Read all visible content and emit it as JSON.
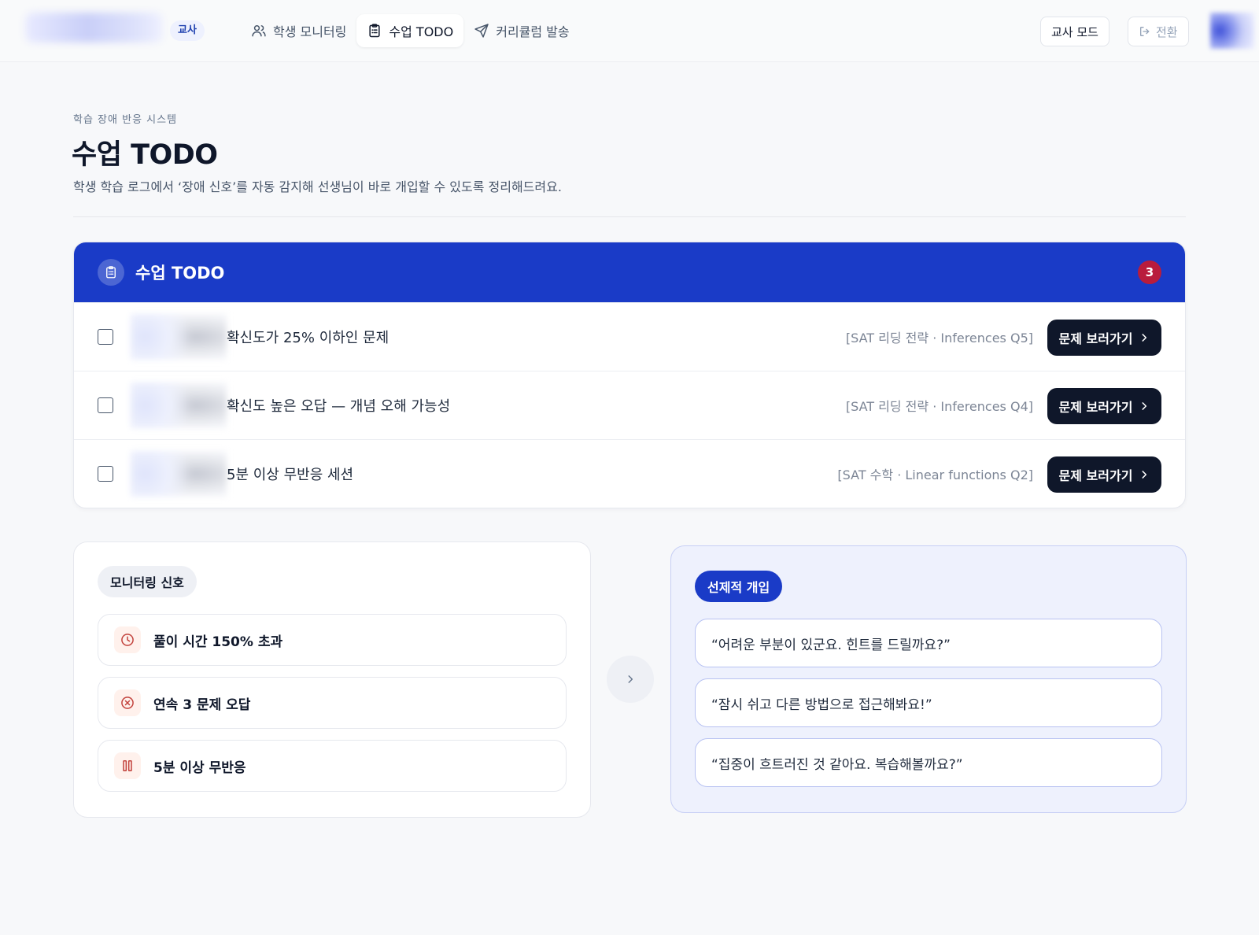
{
  "nav": {
    "role_badge": "교사",
    "items": [
      {
        "label": "학생 모니터링",
        "icon": "users-icon",
        "active": false
      },
      {
        "label": "수업 TODO",
        "icon": "clipboard-icon",
        "active": true
      },
      {
        "label": "커리큘럼 발송",
        "icon": "send-icon",
        "active": false
      }
    ],
    "teacher_mode_label": "교사 모드",
    "switch_label": "전환"
  },
  "header": {
    "kicker": "학습 장애 반응 시스템",
    "title": "수업 TODO",
    "description": "학생 학습 로그에서 ‘장애 신호’를 자동 감지해 선생님이 바로 개입할 수 있도록 정리해드려요."
  },
  "todo": {
    "title": "수업 TODO",
    "count": "3",
    "action_label": "문제 보러가기",
    "items": [
      {
        "text": "확신도가 25% 이하인 문제",
        "source": "[SAT 리딩 전략 · Inferences Q5]"
      },
      {
        "text": "확신도 높은 오답 — 개념 오해 가능성",
        "source": "[SAT 리딩 전략 · Inferences Q4]"
      },
      {
        "text": "5분 이상 무반응 세션",
        "source": "[SAT 수학 · Linear functions Q2]"
      }
    ]
  },
  "signals": {
    "chip": "모니터링 신호",
    "items": [
      {
        "label": "풀이 시간 150% 초과",
        "icon": "clock-icon"
      },
      {
        "label": "연속 3 문제 오답",
        "icon": "x-circle-icon"
      },
      {
        "label": "5분 이상 무반응",
        "icon": "pause-icon"
      }
    ]
  },
  "intervention": {
    "chip": "선제적 개입",
    "quotes": [
      "“어려운 부분이 있군요. 힌트를 드릴까요?”",
      "“잠시 쉬고 다른 방법으로 접근해봐요!”",
      "“집중이 흐트러진 것 같아요. 복습해볼까요?”"
    ]
  },
  "colors": {
    "accent": "#1a3bc7",
    "dark_button": "#0f172a",
    "count_badge": "#b91c3c",
    "signal_icon": "#c2413b"
  }
}
